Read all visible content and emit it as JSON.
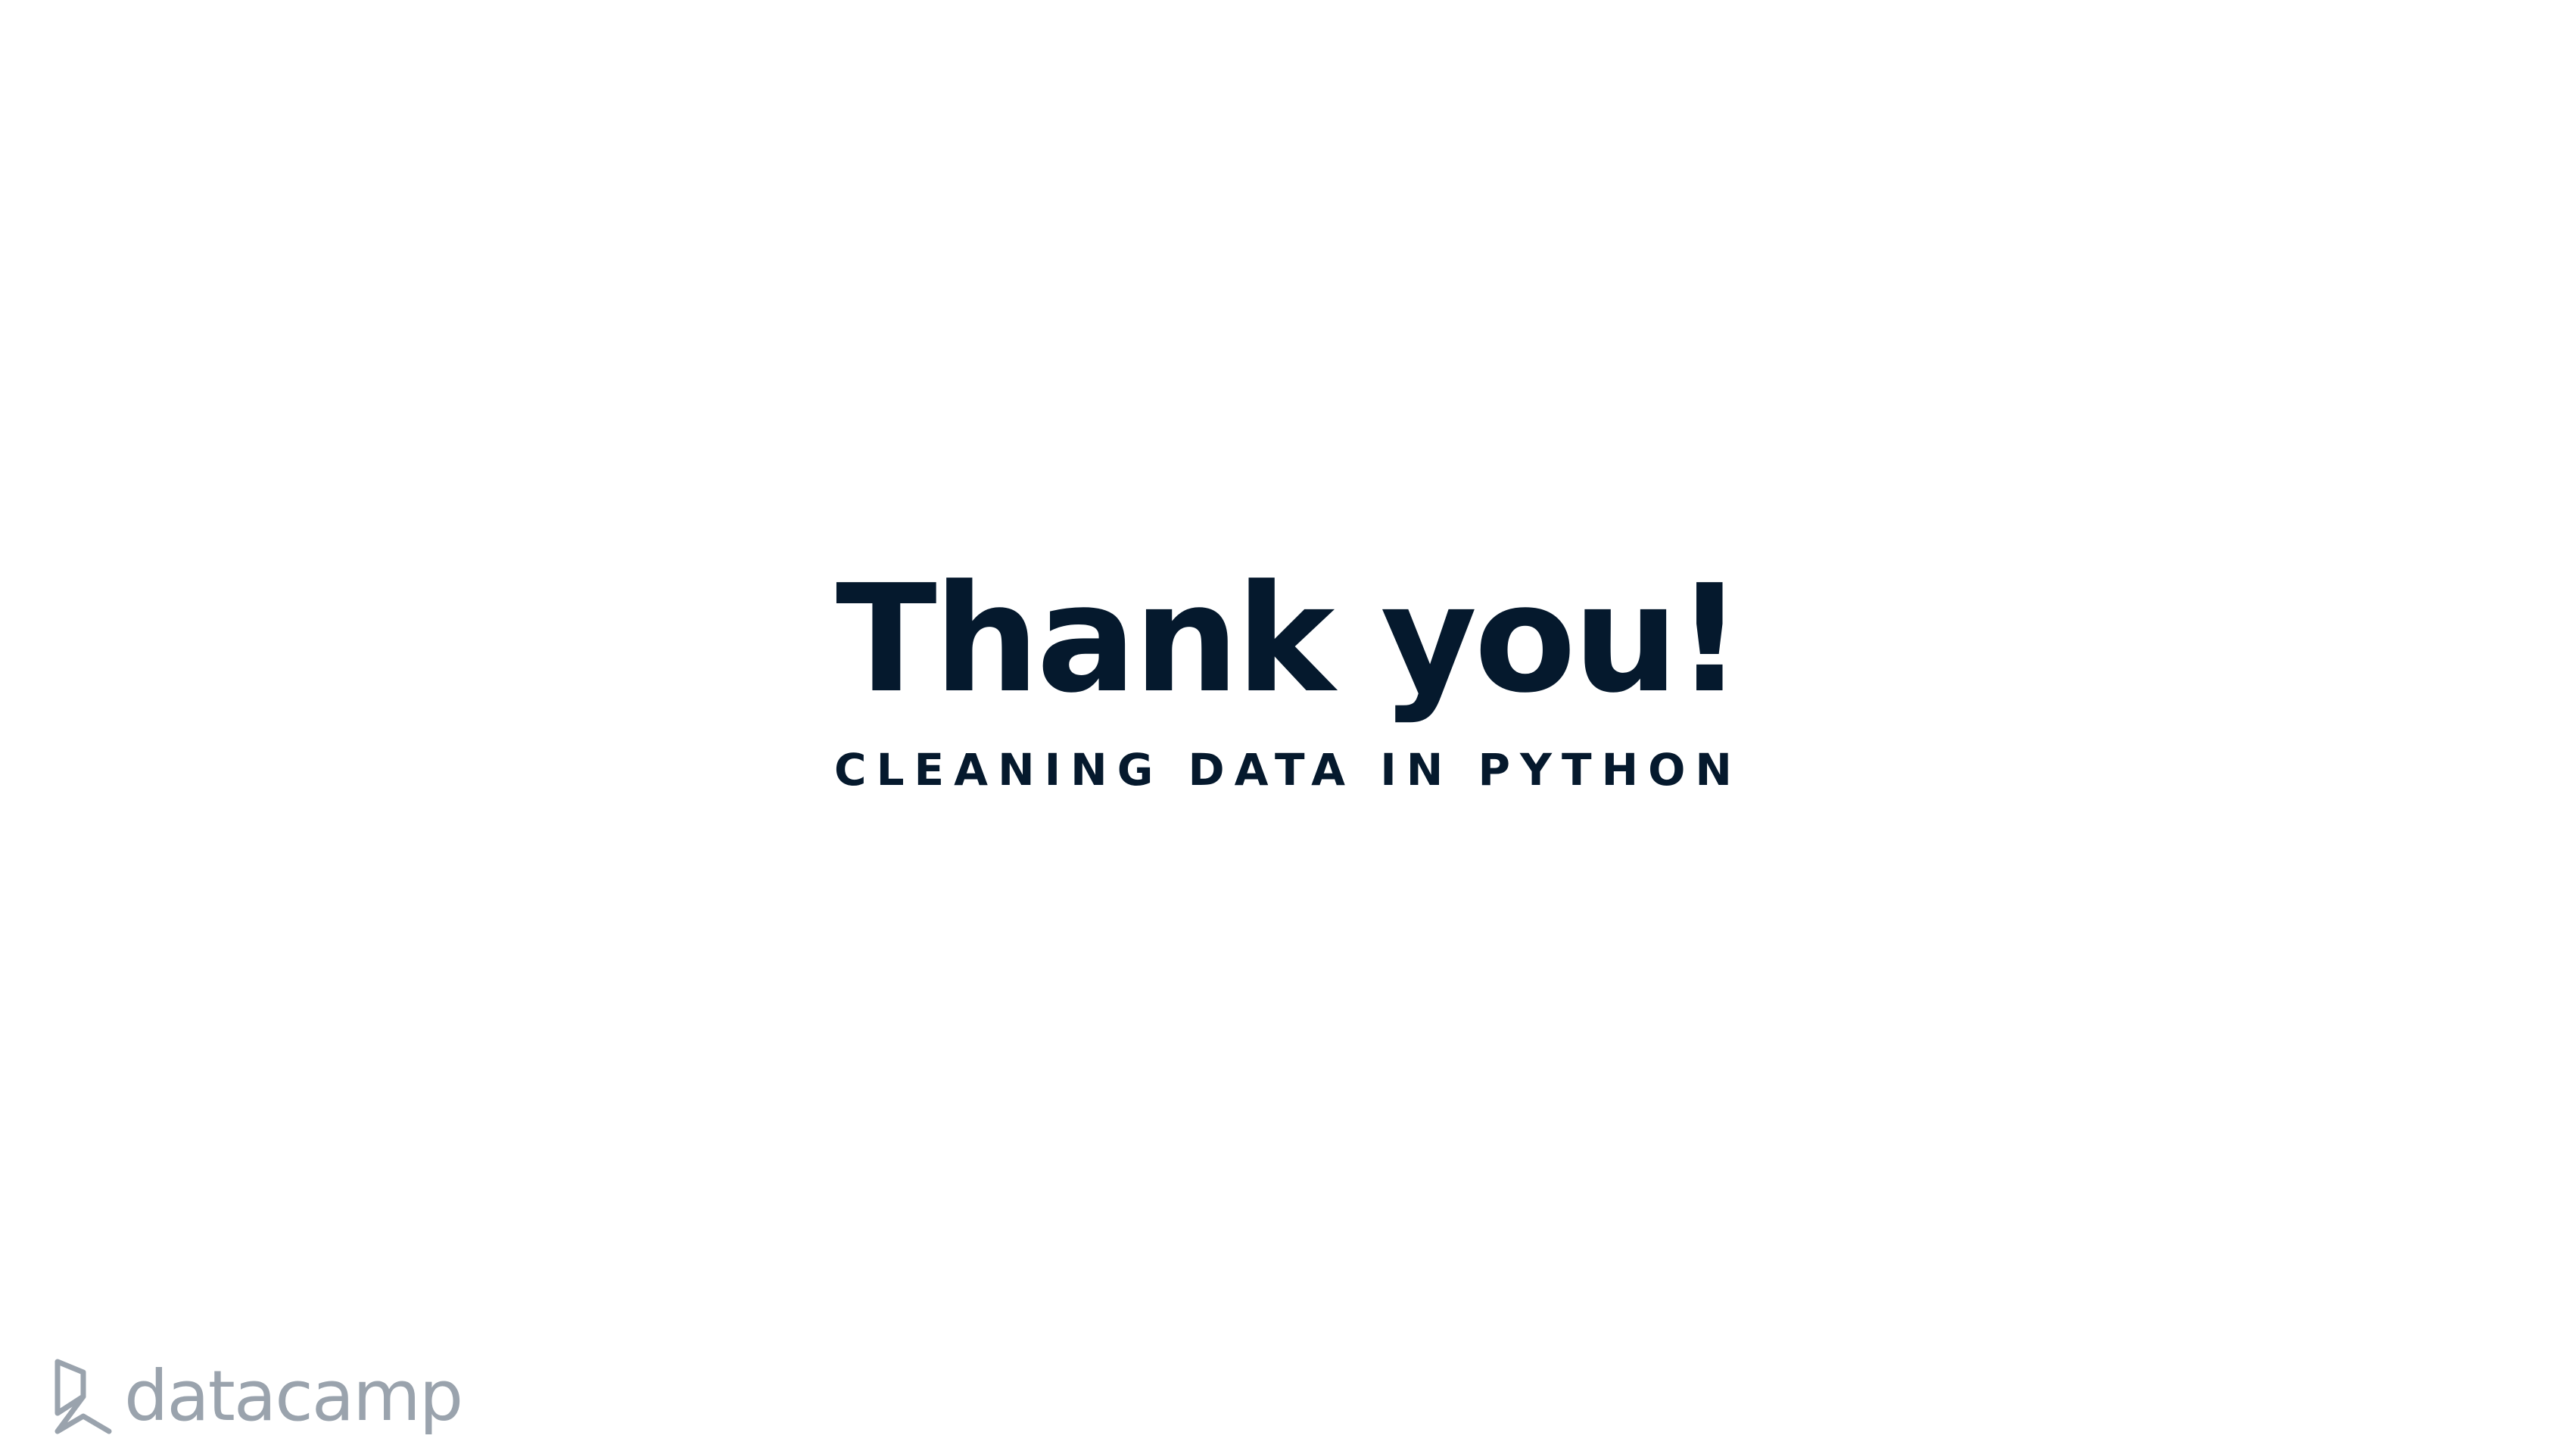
{
  "slide": {
    "title": "Thank you!",
    "subtitle": "CLEANING DATA IN PYTHON"
  },
  "footer": {
    "logo_text": "datacamp",
    "logo_icon": "datacamp-logo-icon"
  },
  "colors": {
    "text": "#05192d",
    "logo": "#9aa3ad",
    "background": "#ffffff"
  }
}
